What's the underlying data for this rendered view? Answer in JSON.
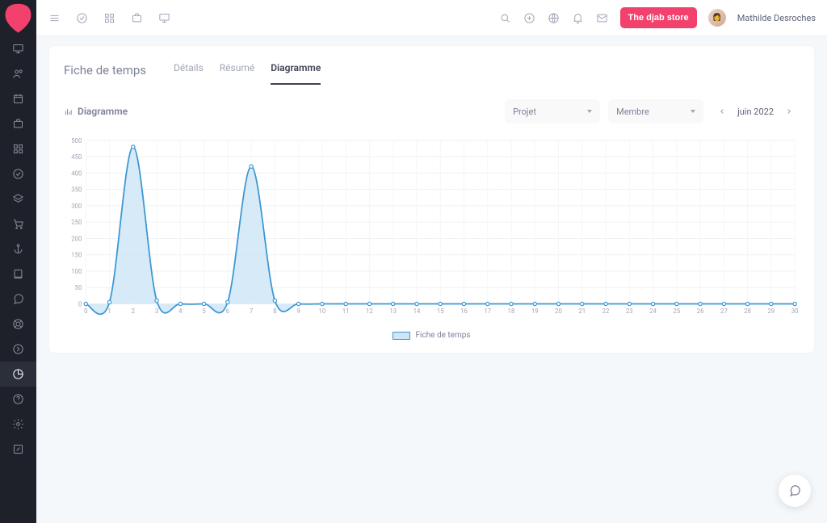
{
  "topbar": {
    "store_button": "The djab store",
    "user_name": "Mathilde Desroches"
  },
  "page": {
    "title": "Fiche de temps",
    "tabs": [
      {
        "label": "Détails",
        "active": false
      },
      {
        "label": "Résumé",
        "active": false
      },
      {
        "label": "Diagramme",
        "active": true
      }
    ],
    "panel_title": "Diagramme",
    "filters": {
      "projet": "Projet",
      "membre": "Membre",
      "period": "juin 2022"
    },
    "legend": "Fiche de temps"
  },
  "chart_data": {
    "type": "area",
    "xlabel": "",
    "ylabel": "",
    "ylim": [
      0,
      500
    ],
    "yticks": [
      0,
      50,
      100,
      150,
      200,
      250,
      300,
      350,
      400,
      450,
      500
    ],
    "categories": [
      0,
      1,
      2,
      3,
      4,
      5,
      6,
      7,
      8,
      9,
      10,
      11,
      12,
      13,
      14,
      15,
      16,
      17,
      18,
      19,
      20,
      21,
      22,
      23,
      24,
      25,
      26,
      27,
      28,
      29,
      30
    ],
    "series": [
      {
        "name": "Fiche de temps",
        "color_line": "#3b97d3",
        "color_fill": "#cfe6f6",
        "values": [
          0,
          5,
          480,
          10,
          0,
          0,
          5,
          420,
          10,
          0,
          0,
          0,
          0,
          0,
          0,
          0,
          0,
          0,
          0,
          0,
          0,
          0,
          0,
          0,
          0,
          0,
          0,
          0,
          0,
          0,
          0
        ]
      }
    ]
  }
}
